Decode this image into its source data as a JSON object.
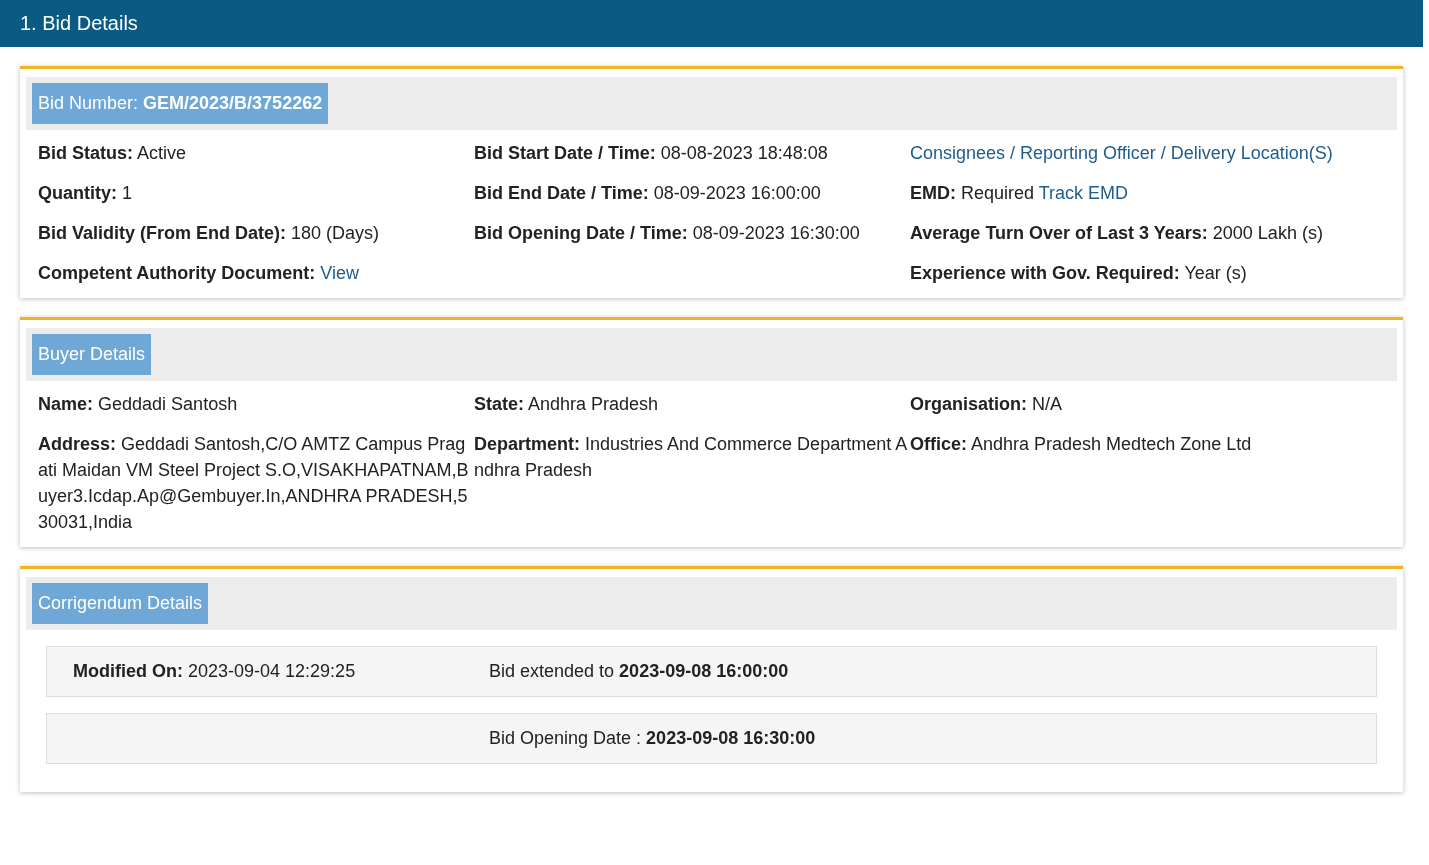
{
  "header": {
    "title": "1. Bid Details"
  },
  "sections": [
    {
      "title": "Bid Number: **GEM/2023/B/3752262**",
      "columns": [
        [
          {
            "label": "Bid Status:",
            "value": "Active"
          },
          {
            "label": "Quantity:",
            "value": "1"
          },
          {
            "label": "Bid Validity (From End Date):",
            "value": "180 (Days)"
          },
          {
            "label": "Competent Authority Document:",
            "link": "View"
          }
        ],
        [
          {
            "label": "Bid Start Date / Time:",
            "value": "08-08-2023 18:48:08"
          },
          {
            "label": "Bid End Date / Time:",
            "value": "08-09-2023 16:00:00"
          },
          {
            "label": "Bid Opening Date / Time:",
            "value": "08-09-2023 16:30:00"
          }
        ],
        [
          {
            "link": "Consignees / Reporting Officer / Delivery Location(S)"
          },
          {
            "label": "EMD:",
            "value": "Required",
            "link": "Track EMD"
          },
          {
            "label": "Average Turn Over of Last 3 Years:",
            "value": "2000 Lakh (s)"
          },
          {
            "label": "Experience with Gov. Required:",
            "value": "Year (s)"
          }
        ]
      ]
    },
    {
      "title": "Buyer Details",
      "columns": [
        [
          {
            "label": "Name:",
            "value": "Geddadi Santosh"
          },
          {
            "label": "Address:",
            "value": "Geddadi Santosh,C/O AMTZ Campus Pragati Maidan VM Steel Project S.O,VISAKHAPATNAM,Buyer3.Icdap.Ap@Gembuyer.In,ANDHRA PRADESH,530031,India"
          }
        ],
        [
          {
            "label": "State:",
            "value": "Andhra Pradesh"
          },
          {
            "label": "Department:",
            "value": "Industries And Commerce Department Andhra Pradesh"
          }
        ],
        [
          {
            "label": "Organisation:",
            "value": "N/A"
          },
          {
            "label": "Office:",
            "value": "Andhra Pradesh Medtech Zone Ltd"
          }
        ]
      ]
    }
  ],
  "corrigendum": {
    "title": "Corrigendum Details",
    "rows": [
      {
        "label": "Modified On:",
        "value": "2023-09-04 12:29:25",
        "note": "Bid extended to **2023-09-08 16:00:00**"
      },
      {
        "note": "Bid Opening Date : **2023-09-08 16:30:00**"
      }
    ]
  }
}
